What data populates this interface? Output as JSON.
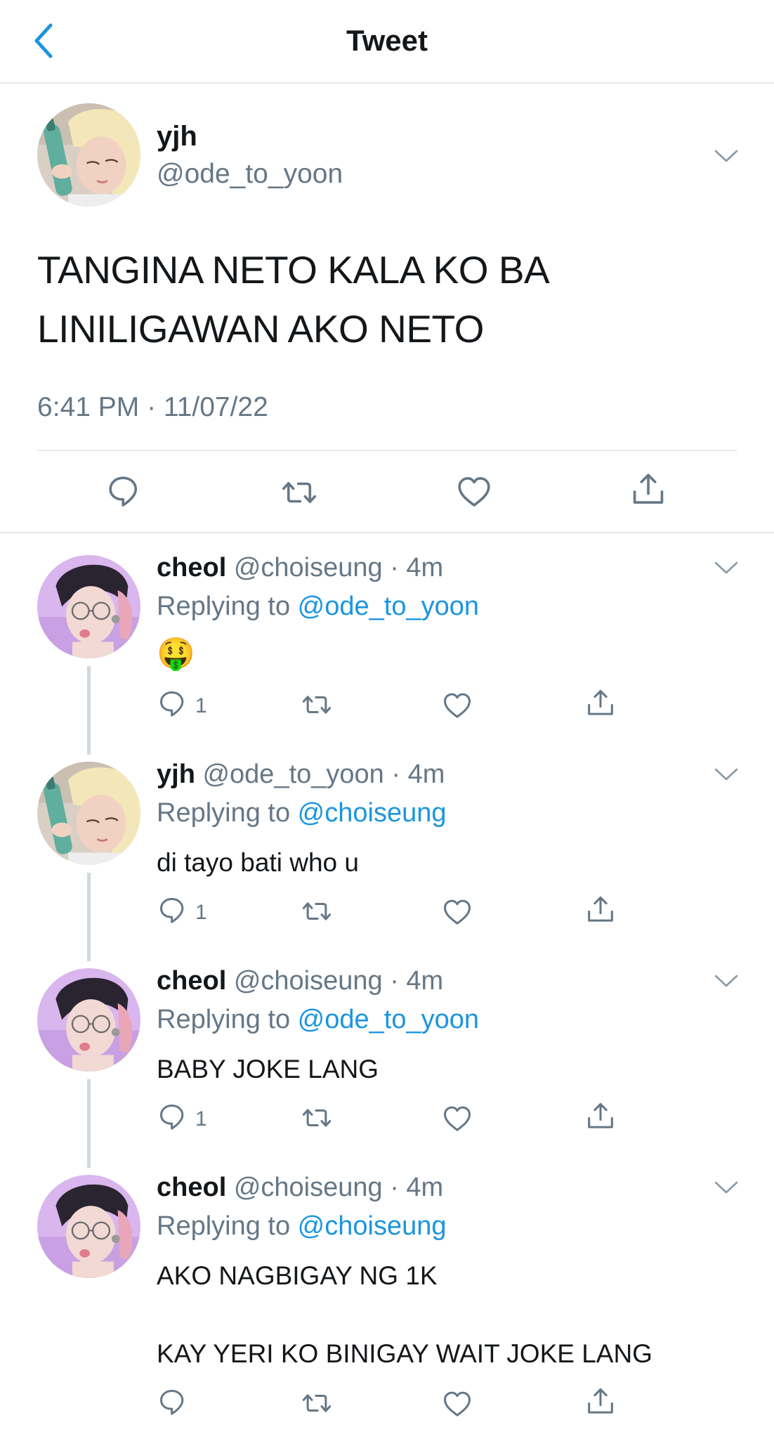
{
  "header": {
    "title": "Tweet"
  },
  "main_tweet": {
    "name": "yjh",
    "handle": "@ode_to_yoon",
    "text_line1": "TANGINA NETO KALA KO BA",
    "text_line2": "LINILIGAWAN AKO NETO",
    "timestamp": "6:41 PM · 11/07/22"
  },
  "replies": [
    {
      "name": "cheol",
      "handle": "@choiseung",
      "time": "· 4m",
      "replying_prefix": "Replying to ",
      "replying_to": "@ode_to_yoon",
      "body": "🤑",
      "reply_count": "1"
    },
    {
      "name": "yjh",
      "handle": "@ode_to_yoon",
      "time": "· 4m",
      "replying_prefix": "Replying to ",
      "replying_to": "@choiseung",
      "body": "di tayo bati who u",
      "reply_count": "1"
    },
    {
      "name": "cheol",
      "handle": "@choiseung",
      "time": "· 4m",
      "replying_prefix": "Replying to ",
      "replying_to": "@ode_to_yoon",
      "body": "BABY JOKE LANG",
      "reply_count": "1"
    },
    {
      "name": "cheol",
      "handle": "@choiseung",
      "time": "· 4m",
      "replying_prefix": "Replying to ",
      "replying_to": "@choiseung",
      "body_line1": "AKO NAGBIGAY NG 1K",
      "body_line2": "KAY YERI KO BINIGAY WAIT JOKE LANG"
    }
  ],
  "colors": {
    "accent": "#1b95e0",
    "secondary_text": "#657786",
    "divider": "#e1e8ed",
    "thread_line": "#cfd9de"
  },
  "icons": [
    "back-chevron-icon",
    "chevron-down-icon",
    "reply-icon",
    "retweet-icon",
    "like-icon",
    "share-icon"
  ]
}
